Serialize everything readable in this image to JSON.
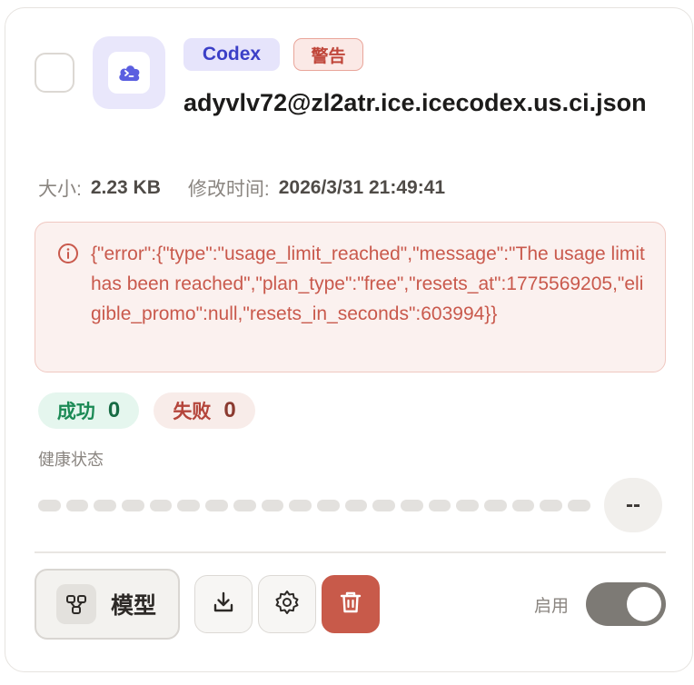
{
  "badges": {
    "provider": "Codex",
    "warning": "警告"
  },
  "file": {
    "name": "adyvlv72@zl2atr.ice.icecodex.us.ci.json"
  },
  "meta": {
    "size_label": "大小:",
    "size_value": "2.23 KB",
    "modified_label": "修改时间:",
    "modified_value": "2026/3/31 21:49:41"
  },
  "error": {
    "message": "{\"error\":{\"type\":\"usage_limit_reached\",\"message\":\"The usage limit has been reached\",\"plan_type\":\"free\",\"resets_at\":1775569205,\"eligible_promo\":null,\"resets_in_seconds\":603994}}"
  },
  "stats": {
    "success_label": "成功",
    "success_count": "0",
    "fail_label": "失败",
    "fail_count": "0"
  },
  "health": {
    "label": "健康状态",
    "score": "--",
    "segments": 20
  },
  "actions": {
    "model_label": "模型",
    "enable_label": "启用",
    "enabled": true
  },
  "colors": {
    "accent": "#3b3fc7",
    "danger": "#c85a4a",
    "success": "#1b8a55"
  },
  "icons": {
    "app": "terminal-cloud-icon",
    "error": "info-circle-icon",
    "model": "model-nodes-icon",
    "download": "download-icon",
    "settings": "gear-icon",
    "delete": "trash-icon"
  }
}
